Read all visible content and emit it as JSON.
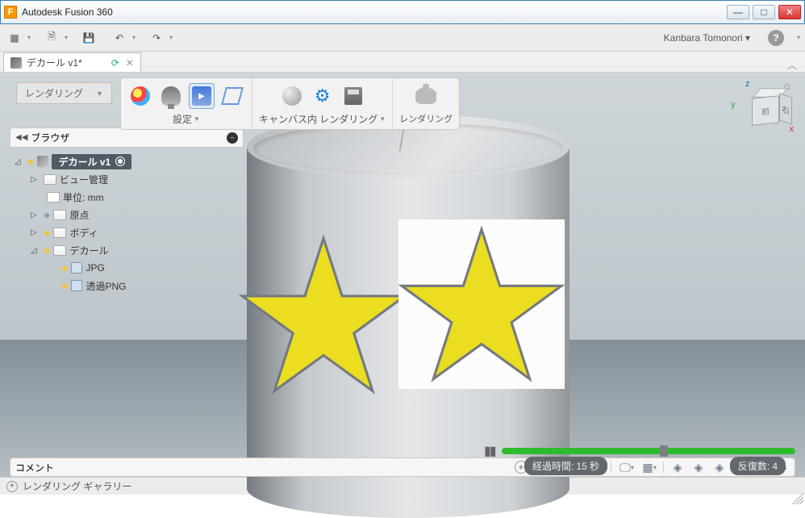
{
  "window": {
    "title": "Autodesk Fusion 360"
  },
  "user": {
    "name": "Kanbara Tomonori"
  },
  "document": {
    "tab_name": "デカール v1",
    "dirty_mark": "*"
  },
  "workspace": {
    "label": "レンダリング"
  },
  "ribbon": {
    "group_setup": "設定",
    "group_canvasrender": "キャンバス内 レンダリング",
    "group_render": "レンダリング"
  },
  "browser": {
    "title": "ブラウザ",
    "root": "デカール v1",
    "items": {
      "view_mgmt": "ビュー管理",
      "units": "単位: mm",
      "origin": "原点",
      "body": "ボディ",
      "decal": "デカール",
      "jpg": "JPG",
      "png": "透過PNG"
    }
  },
  "viewcube": {
    "front": "前",
    "right": "右",
    "axis_z": "z",
    "axis_y": "y",
    "axis_x": "x"
  },
  "status": {
    "elapsed_label": "経過時間:",
    "elapsed_value": "15 秒",
    "iter_label": "反復数:",
    "iter_value": "4"
  },
  "comment": {
    "label": "コメント"
  },
  "gallery": {
    "label": "レンダリング ギャラリー"
  }
}
